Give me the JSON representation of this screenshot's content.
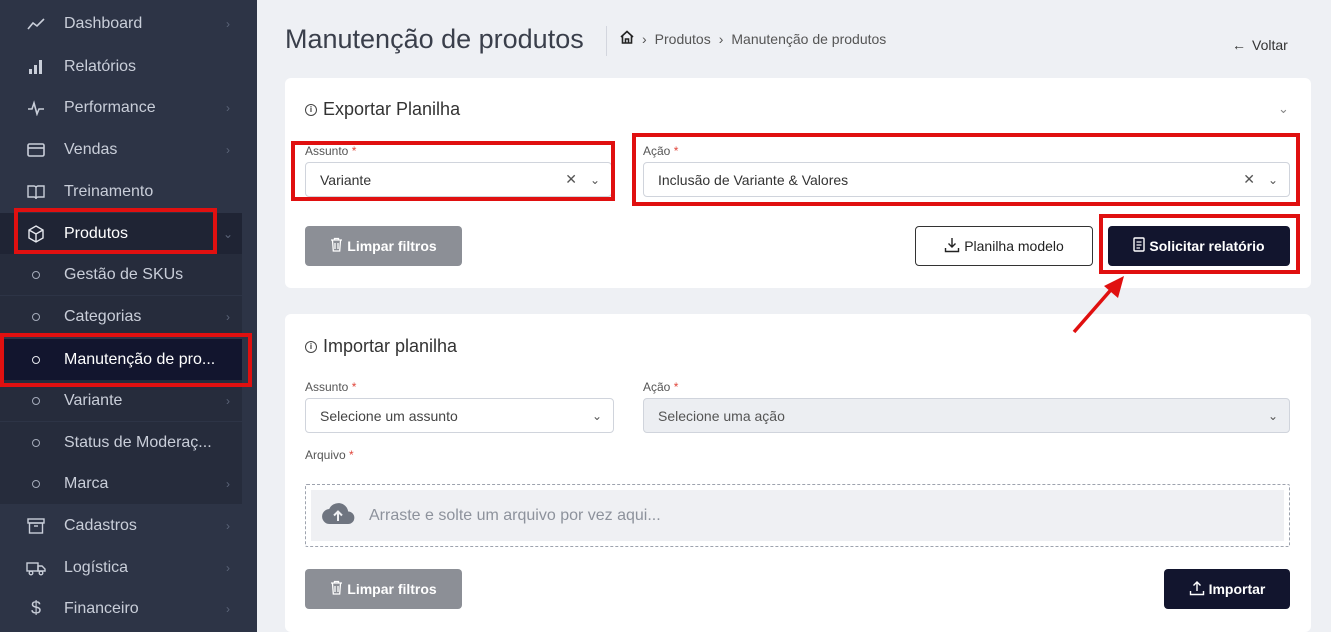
{
  "sidebar": {
    "items": [
      {
        "label": "Dashboard",
        "icon": "trend-icon",
        "chevron": true
      },
      {
        "label": "Relatórios",
        "icon": "bar-chart-icon",
        "chevron": false
      },
      {
        "label": "Performance",
        "icon": "pulse-icon",
        "chevron": true
      },
      {
        "label": "Vendas",
        "icon": "card-icon",
        "chevron": true
      },
      {
        "label": "Treinamento",
        "icon": "book-icon",
        "chevron": false
      },
      {
        "label": "Produtos",
        "icon": "box-icon",
        "chevron": true
      },
      {
        "label": "Gestão de SKUs"
      },
      {
        "label": "Categorias"
      },
      {
        "label": "Manutenção de pro..."
      },
      {
        "label": "Variante"
      },
      {
        "label": "Status de Moderaç..."
      },
      {
        "label": "Marca"
      },
      {
        "label": "Cadastros",
        "icon": "archive-icon",
        "chevron": true
      },
      {
        "label": "Logística",
        "icon": "truck-icon",
        "chevron": true
      },
      {
        "label": "Financeiro",
        "icon": "dollar-icon",
        "chevron": true
      }
    ]
  },
  "header": {
    "title": "Manutenção de produtos",
    "breadcrumb": [
      "Produtos",
      "Manutenção de produtos"
    ],
    "back_label": "Voltar"
  },
  "export": {
    "title": "Exportar Planilha",
    "assunto_label": "Assunto",
    "assunto_value": "Variante",
    "acao_label": "Ação",
    "acao_value": "Inclusão de Variante & Valores",
    "clear_label": "Limpar filtros",
    "template_label": "Planilha modelo",
    "request_label": "Solicitar relatório"
  },
  "import": {
    "title": "Importar planilha",
    "assunto_label": "Assunto",
    "assunto_placeholder": "Selecione um assunto",
    "acao_label": "Ação",
    "acao_placeholder": "Selecione uma ação",
    "file_label": "Arquivo",
    "dropzone_text": "Arraste e solte um arquivo por vez aqui...",
    "clear_label": "Limpar filtros",
    "import_label": "Importar"
  },
  "colors": {
    "sidebar_bg": "#2d3446",
    "primary_dark": "#12152e",
    "highlight_red": "#e01010"
  }
}
